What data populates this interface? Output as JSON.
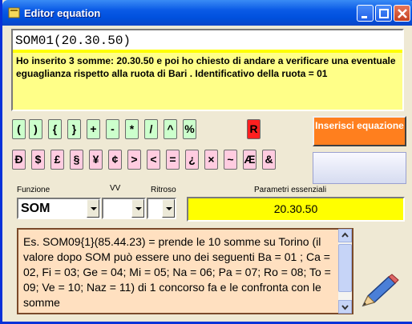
{
  "window": {
    "title": "Editor equation"
  },
  "editor": {
    "code": "SOM01(20.30.50)",
    "description": "Ho inserito 3 somme: 20.30.50 e poi ho chiesto di andare a verificare una eventuale eguaglianza rispetto alla ruota di Bari . Identificativo della ruota = 01"
  },
  "keys_row1": [
    "(",
    ")",
    "{",
    "}",
    "+",
    "-",
    "*",
    "/",
    "^",
    "%"
  ],
  "key_r": "R",
  "keys_row2": [
    "Ð",
    "$",
    "£",
    "§",
    "¥",
    "¢",
    ">",
    "<",
    "=",
    "¿",
    "×",
    "~",
    "Æ",
    "&"
  ],
  "insert_button": "Inserisci equazione",
  "labels": {
    "funzione": "Funzione",
    "vv": "VV",
    "ritroso": "Ritroso",
    "parametri": "Parametri essenziali"
  },
  "funzione_value": "SOM",
  "parametri_value": "20.30.50",
  "help_text": "Es. SOM09{1}(85.44.23) = prende le 10 somme su Torino  (il valore dopo SOM può essere uno dei seguenti  Ba = 01 ; Ca = 02, Fi = 03; Ge = 04; Mi = 05; Na = 06; Pa = 07; Ro = 08; To = 09; Ve = 10; Naz = 11) di 1 concorso fa e le confronta con le somme",
  "colors": {
    "accent": "#0a5ae6",
    "insert_button": "#ff7f1e",
    "params": "#ffff00",
    "editor": "#ffff88"
  }
}
